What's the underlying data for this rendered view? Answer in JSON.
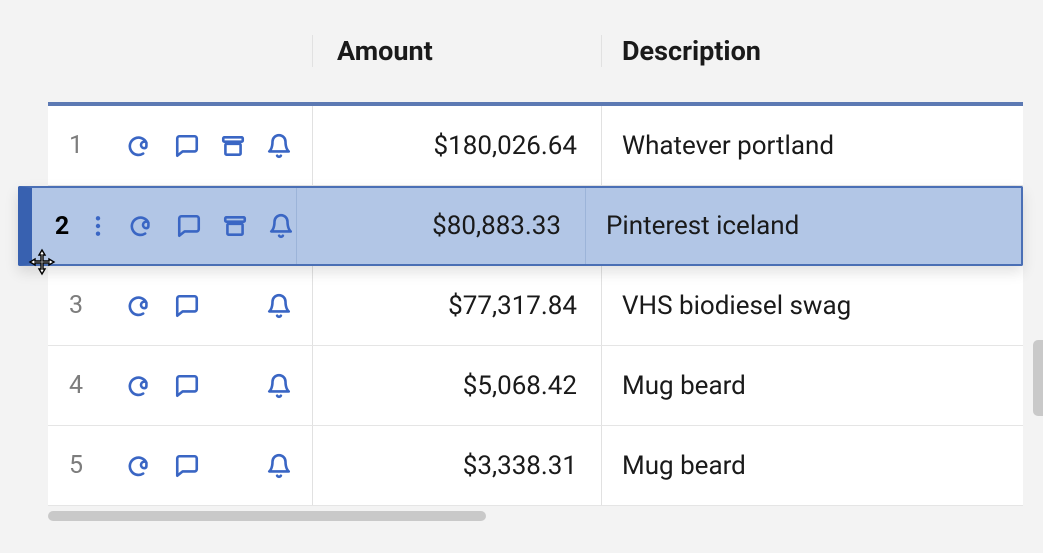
{
  "headers": {
    "amount": "Amount",
    "description": "Description"
  },
  "icon_colors": {
    "primary": "#3a66c4"
  },
  "rows": [
    {
      "num": "1",
      "amount": "$180,026.64",
      "description": "Whatever portland",
      "icons": [
        "at",
        "comment",
        "archive",
        "bell"
      ],
      "selected": false
    },
    {
      "num": "2",
      "amount": "$80,883.33",
      "description": "Pinterest iceland",
      "icons": [
        "at",
        "comment",
        "archive",
        "bell"
      ],
      "selected": true
    },
    {
      "num": "3",
      "amount": "$77,317.84",
      "description": "VHS biodiesel swag",
      "icons": [
        "at",
        "comment",
        "bell"
      ],
      "selected": false
    },
    {
      "num": "4",
      "amount": "$5,068.42",
      "description": "Mug beard",
      "icons": [
        "at",
        "comment",
        "bell"
      ],
      "selected": false
    },
    {
      "num": "5",
      "amount": "$3,338.31",
      "description": "Mug beard",
      "icons": [
        "at",
        "comment",
        "bell"
      ],
      "selected": false
    }
  ]
}
